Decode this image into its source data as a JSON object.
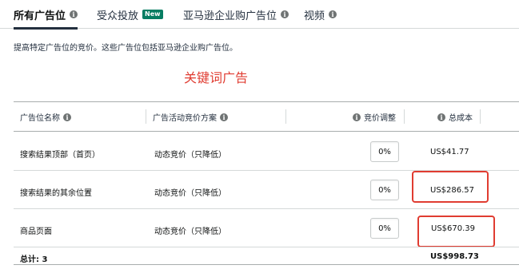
{
  "tabs": [
    {
      "label": "所有广告位",
      "active": true
    },
    {
      "label": "受众投放",
      "badge": "New"
    },
    {
      "label": "亚马逊企业购广告位"
    },
    {
      "label": "视频"
    }
  ],
  "description": "提高特定广告位的竞价。这些广告位包括亚马逊企业购广告位。",
  "annotation": "关键词广告",
  "table": {
    "headers": {
      "placement": "广告位名称",
      "strategy": "广告活动竞价方案",
      "bid_adjust": "竞价调整",
      "total_cost": "总成本"
    },
    "rows": [
      {
        "placement": "搜索结果顶部（首页）",
        "strategy": "动态竞价（只降低）",
        "bid_adjust": "0%",
        "cost": "US$41.77",
        "highlighted": false
      },
      {
        "placement": "搜索结果的其余位置",
        "strategy": "动态竞价（只降低）",
        "bid_adjust": "0%",
        "cost": "US$286.57",
        "highlighted": true
      },
      {
        "placement": "商品页面",
        "strategy": "动态竞价（只降低）",
        "bid_adjust": "0%",
        "cost": "US$670.39",
        "highlighted": true
      }
    ],
    "footer": {
      "label": "总计: 3",
      "total_cost": "US$998.73"
    }
  },
  "colors": {
    "annotation": "#e03c31",
    "badge": "#067d62",
    "active_tab_underline": "#232f3e"
  }
}
